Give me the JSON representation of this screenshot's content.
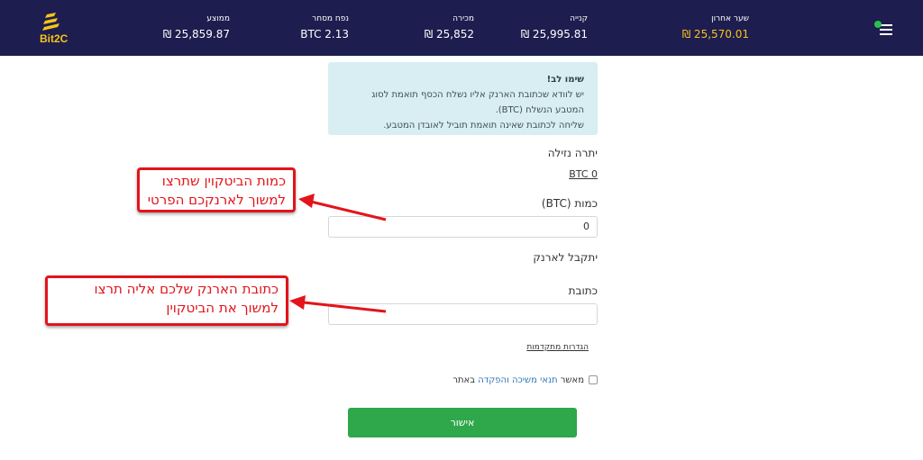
{
  "header": {
    "logo_text": "Bit2C",
    "stats": [
      {
        "label": "שער אחרון",
        "value": "₪ 25,570.01"
      },
      {
        "label": "קנייה",
        "value": "₪ 25,995.81"
      },
      {
        "label": "מכירה",
        "value": "₪ 25,852"
      },
      {
        "label": "נפח מסחר",
        "value": "BTC 2.13"
      },
      {
        "label": "ממוצע",
        "value": "₪ 25,859.87"
      }
    ]
  },
  "notice": {
    "title": "שימו לב!",
    "line1": "יש לוודא שכתובת הארנק אליו נשלח הכסף תואמת לסוג",
    "line2": "המטבע הנשלח (BTC).",
    "line3": "שליחה לכתובת שאינה תואמת תוביל לאובדן המטבע."
  },
  "form": {
    "available_label": "יתרה נזילה",
    "available_value": "BTC 0",
    "amount_label": "כמות (BTC)",
    "amount_value": "0",
    "wallet_heading": "יתקבל לארנק",
    "address_label": "כתובת",
    "address_value": "",
    "advanced_link": "הגדרות מתקדמות",
    "terms_prefix": "מאשר",
    "terms_link": "תנאי משיכה והפקדה",
    "terms_suffix": "באתר",
    "confirm_button": "אישור"
  },
  "annotations": {
    "amount_line1": "כמות הביטקוין שתרצו",
    "amount_line2": "למשוך לארנקכם הפרטי",
    "address_line1": "כתובת הארנק שלכם אליה תרצו",
    "address_line2": "למשוך את הביטקוין"
  },
  "colors": {
    "header_bg": "#1e1d4f",
    "accent_gold": "#f5c518",
    "confirm_green": "#2ea84a",
    "annotation_red": "#e3141b",
    "notice_bg": "#d8eef3"
  }
}
